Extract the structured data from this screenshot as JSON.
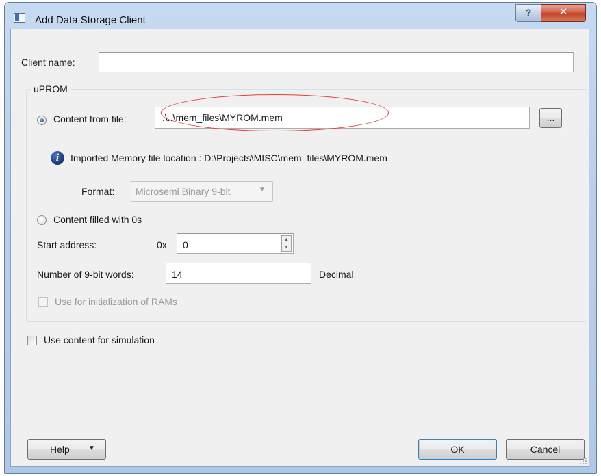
{
  "window": {
    "title": "Add Data Storage Client",
    "help_glyph": "?",
    "close_glyph": "✕"
  },
  "client_name": {
    "label": "Client name:",
    "value": ""
  },
  "uprom": {
    "group_title": "uPROM",
    "content_from_file": {
      "label": "Content from file:",
      "selected": true,
      "path_value": ".\\..\\mem_files\\MYROM.mem",
      "browse_label": "..."
    },
    "info_text": "Imported Memory file location : D:\\Projects\\MISC\\mem_files\\MYROM.mem",
    "format": {
      "label": "Format:",
      "selected": "Microsemi Binary 9-bit"
    },
    "content_filled": {
      "label": "Content filled with 0s",
      "selected": false
    },
    "start_address": {
      "label": "Start address:",
      "prefix": "0x",
      "value": "0"
    },
    "word_count": {
      "label": "Number of 9-bit words:",
      "value": "14",
      "unit": "Decimal"
    },
    "init_rams": {
      "label": "Use for initialization of RAMs",
      "checked": false,
      "enabled": false
    }
  },
  "simulation": {
    "label": "Use content for simulation",
    "checked": false
  },
  "footer": {
    "help_label": "Help",
    "ok_label": "OK",
    "cancel_label": "Cancel"
  },
  "icons": [
    "app-window-icon",
    "help-icon",
    "close-icon",
    "info-icon",
    "dropdown-arrow-icon",
    "spin-up-icon",
    "spin-down-icon",
    "resize-grip-icon"
  ],
  "colors": {
    "annotation_ellipse": "#e0403a",
    "title_bar": "#b9d0ea",
    "close_button": "#c44328"
  }
}
